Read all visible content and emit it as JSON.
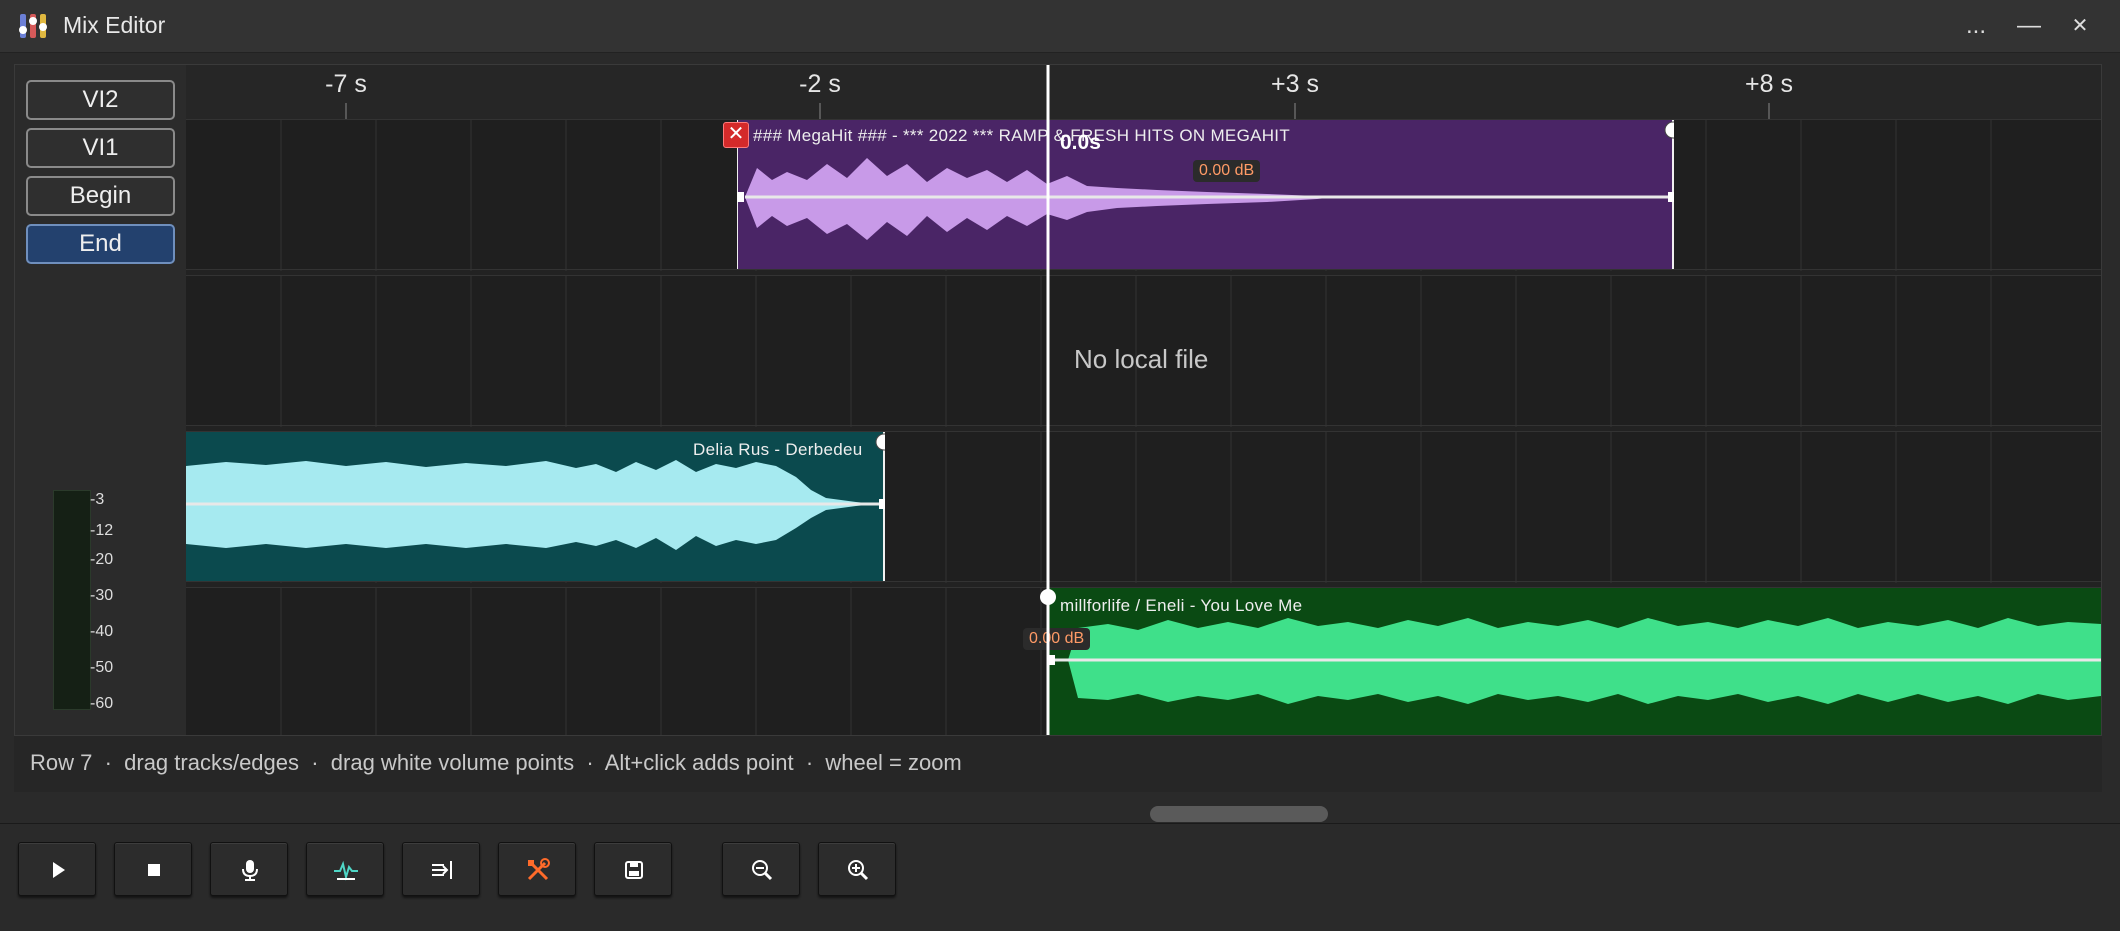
{
  "window": {
    "title": "Mix Editor",
    "more_glyph": "...",
    "minimize_glyph": "—",
    "close_glyph": "✕"
  },
  "markers": [
    {
      "label": "VI2",
      "active": false
    },
    {
      "label": "VI1",
      "active": false
    },
    {
      "label": "Begin",
      "active": false
    },
    {
      "label": "End",
      "active": true
    }
  ],
  "meter": {
    "labels": [
      "-3",
      "-12",
      "-20",
      "-30",
      "-40",
      "-50",
      "-60"
    ]
  },
  "ruler": {
    "ticks": [
      "-7 s",
      "-2 s",
      "+3 s",
      "+8 s"
    ]
  },
  "playhead": {
    "time_label": "0.0s"
  },
  "tracks": [
    {
      "label": "### MegaHit ### - *** 2022 *** RAMP & FRESH HITS ON MEGAHIT",
      "gain": "0.00 dB",
      "color": "#4a2566",
      "wave_color": "#c89ae8"
    },
    {
      "label": "No local file"
    },
    {
      "label": "Delia Rus - Derbedeu",
      "color": "#0b4a4e",
      "wave_color": "#a6eaf0"
    },
    {
      "label": "millforlife / Eneli - You Love Me",
      "gain": "0.00 dB",
      "color": "#0a4a13",
      "wave_color": "#3fe08a"
    }
  ],
  "status": {
    "text": "Row 7  ·  drag tracks/edges  ·  drag white volume points  ·  Alt+click adds point  ·  wheel = zoom"
  },
  "toolbar": {
    "buttons": [
      "play-icon",
      "stop-icon",
      "microphone-icon",
      "waveform-icon",
      "align-end-icon",
      "tools-icon",
      "save-icon",
      "zoom-out-icon",
      "zoom-in-icon"
    ]
  }
}
